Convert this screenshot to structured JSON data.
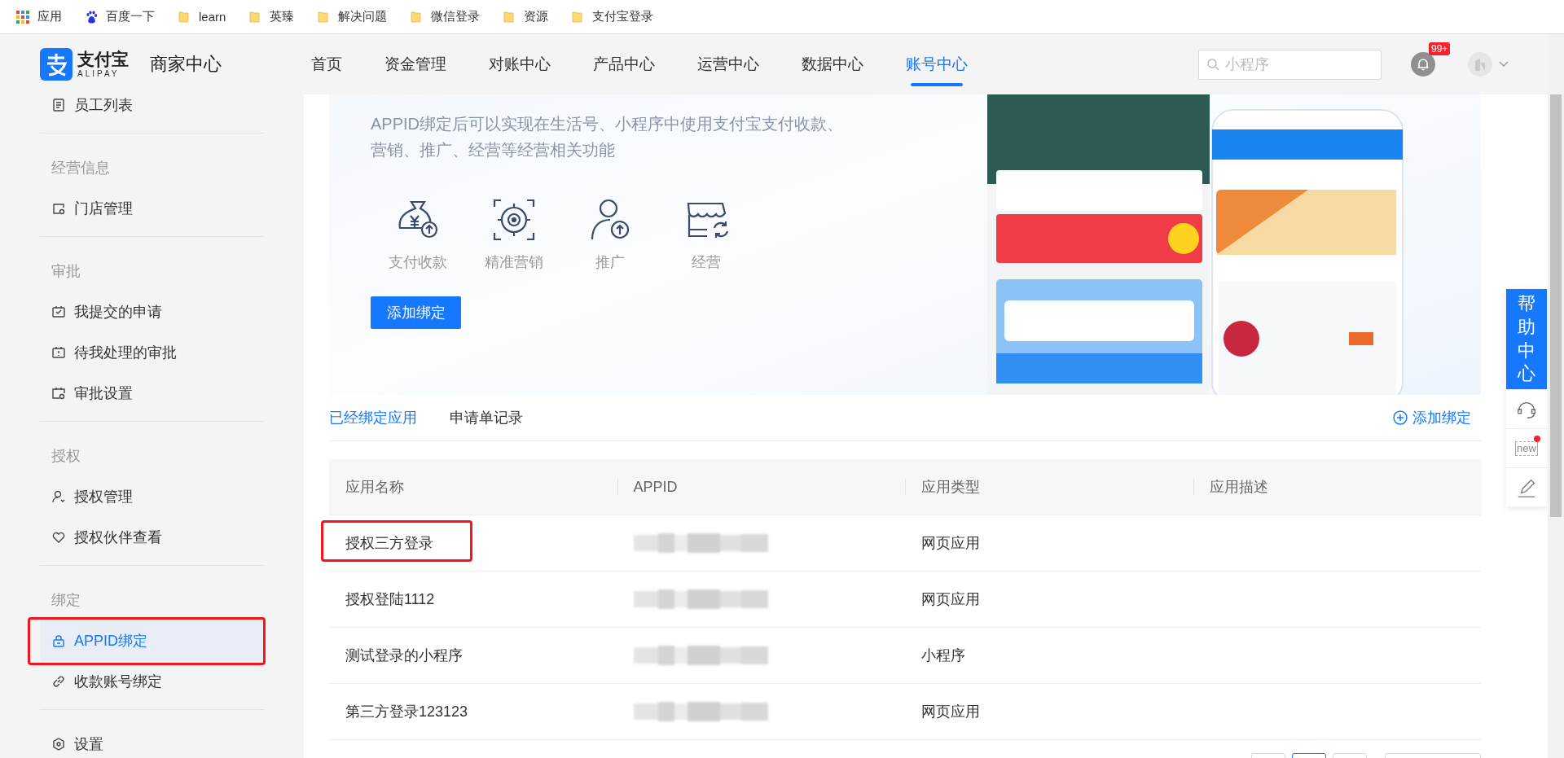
{
  "bookmarks": [
    {
      "kind": "apps",
      "label": "应用"
    },
    {
      "kind": "baidu",
      "label": "百度一下"
    },
    {
      "kind": "folder",
      "label": "learn"
    },
    {
      "kind": "folder",
      "label": "英臻"
    },
    {
      "kind": "folder",
      "label": "解决问题"
    },
    {
      "kind": "folder",
      "label": "微信登录"
    },
    {
      "kind": "folder",
      "label": "资源"
    },
    {
      "kind": "folder",
      "label": "支付宝登录"
    }
  ],
  "header": {
    "brand": "支付宝",
    "brand_sub": "ALIPAY",
    "product": "商家中心",
    "nav": [
      {
        "label": "首页",
        "selected": false
      },
      {
        "label": "资金管理",
        "selected": false
      },
      {
        "label": "对账中心",
        "selected": false
      },
      {
        "label": "产品中心",
        "selected": false
      },
      {
        "label": "运营中心",
        "selected": false
      },
      {
        "label": "数据中心",
        "selected": false
      },
      {
        "label": "账号中心",
        "selected": true
      }
    ],
    "search": {
      "placeholder": "小程序"
    },
    "notifications": "99+"
  },
  "sidebar": {
    "groups": [
      {
        "items": [
          {
            "kind": "list",
            "label": "员工列表",
            "selected": false,
            "highlighted": false
          }
        ]
      },
      {
        "heading": "经营信息",
        "items": [
          {
            "kind": "store",
            "label": "门店管理",
            "selected": false,
            "highlighted": false
          }
        ]
      },
      {
        "heading": "审批",
        "items": [
          {
            "kind": "check",
            "label": "我提交的申请",
            "selected": false,
            "highlighted": false
          },
          {
            "kind": "alert",
            "label": "待我处理的审批",
            "selected": false,
            "highlighted": false
          },
          {
            "kind": "settings",
            "label": "审批设置",
            "selected": false,
            "highlighted": false
          }
        ]
      },
      {
        "heading": "授权",
        "items": [
          {
            "kind": "user",
            "label": "授权管理",
            "selected": false,
            "highlighted": false
          },
          {
            "kind": "heart",
            "label": "授权伙伴查看",
            "selected": false,
            "highlighted": false
          }
        ]
      },
      {
        "heading": "绑定",
        "items": [
          {
            "kind": "lock",
            "label": "APPID绑定",
            "selected": true,
            "highlighted": true
          },
          {
            "kind": "link",
            "label": "收款账号绑定",
            "selected": false,
            "highlighted": false
          }
        ]
      },
      {
        "items": [
          {
            "kind": "hexagon",
            "label": "设置",
            "selected": false,
            "highlighted": false
          }
        ]
      }
    ]
  },
  "banner": {
    "description": "APPID绑定后可以实现在生活号、小程序中使用支付宝支付收款、营销、推广、经营等经营相关功能",
    "features": [
      {
        "kind": "money-bag",
        "label": "支付收款"
      },
      {
        "kind": "target",
        "label": "精准营销"
      },
      {
        "kind": "person-up",
        "label": "推广"
      },
      {
        "kind": "store-refresh",
        "label": "经营"
      }
    ],
    "button": "添加绑定"
  },
  "tabs": [
    {
      "label": "已经绑定应用",
      "selected": true
    },
    {
      "label": "申请单记录",
      "selected": false
    }
  ],
  "add_link": "添加绑定",
  "table": {
    "columns": [
      "应用名称",
      "APPID",
      "应用类型",
      "应用描述"
    ],
    "rows": [
      {
        "name": "授权三方登录",
        "appid_redacted": true,
        "type": "网页应用",
        "highlighted": true
      },
      {
        "name": "授权登陆1112",
        "appid_redacted": true,
        "type": "网页应用",
        "highlighted": false
      },
      {
        "name": "测试登录的小程序",
        "appid_redacted": true,
        "type": "小程序",
        "highlighted": false
      },
      {
        "name": "第三方登录123123",
        "appid_redacted": true,
        "type": "网页应用",
        "highlighted": false
      }
    ]
  },
  "pagination": {
    "pages": [
      {
        "selected": false
      },
      {
        "selected": true
      },
      {
        "selected": false
      }
    ]
  },
  "help_panel": {
    "title": "帮助中心",
    "tools": [
      {
        "kind": "headset"
      },
      {
        "kind": "new",
        "label": "new",
        "dot": true
      },
      {
        "kind": "edit"
      }
    ]
  }
}
